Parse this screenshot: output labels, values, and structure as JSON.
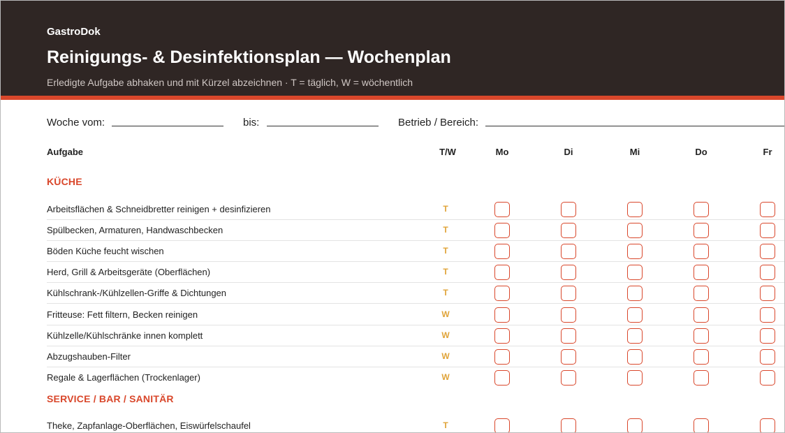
{
  "header": {
    "brand": "GastroDok",
    "title": "Reinigungs- & Desinfektionsplan — Wochenplan",
    "subtitle": "Erledigte Aufgabe abhaken und mit Kürzel abzeichnen · T = täglich, W = wöchentlich"
  },
  "meta": {
    "week_from_label": "Woche vom:",
    "week_to_label": "bis:",
    "location_label": "Betrieb / Bereich:"
  },
  "columns": {
    "task": "Aufgabe",
    "freq": "T/W",
    "days": [
      "Mo",
      "Di",
      "Mi",
      "Do",
      "Fr"
    ]
  },
  "sections": [
    {
      "title": "KÜCHE",
      "rows": [
        {
          "task": "Arbeitsflächen & Schneidbretter reinigen + desinfizieren",
          "freq": "T"
        },
        {
          "task": "Spülbecken, Armaturen, Handwaschbecken",
          "freq": "T"
        },
        {
          "task": "Böden Küche feucht wischen",
          "freq": "T"
        },
        {
          "task": "Herd, Grill & Arbeitsgeräte (Oberflächen)",
          "freq": "T"
        },
        {
          "task": "Kühlschrank-/Kühlzellen-Griffe & Dichtungen",
          "freq": "T"
        },
        {
          "task": "Fritteuse: Fett filtern, Becken reinigen",
          "freq": "W"
        },
        {
          "task": "Kühlzelle/Kühlschränke innen komplett",
          "freq": "W"
        },
        {
          "task": "Abzugshauben-Filter",
          "freq": "W"
        },
        {
          "task": "Regale & Lagerflächen (Trockenlager)",
          "freq": "W"
        }
      ]
    },
    {
      "title": "SERVICE / BAR / SANITÄR",
      "rows": [
        {
          "task": "Theke, Zapfanlage-Oberflächen, Eiswürfelschaufel",
          "freq": "T"
        }
      ]
    }
  ]
}
